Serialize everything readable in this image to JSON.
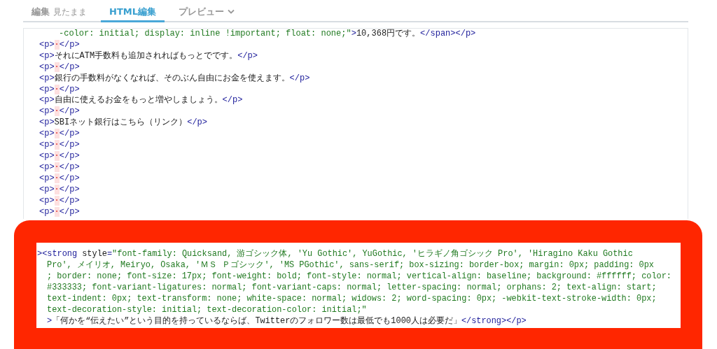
{
  "tabs": [
    {
      "label": "編集",
      "note": "見たまま",
      "selected": false,
      "has_menu": false
    },
    {
      "label": "HTML編集",
      "selected": true,
      "has_menu": false
    },
    {
      "label": "プレビュー",
      "selected": false,
      "has_menu": true
    }
  ],
  "editor_lines": [
    {
      "indent": true,
      "segments": [
        {
          "kind": "attr",
          "text": "-color: initial; display: inline !important; float: none;\""
        },
        {
          "kind": "tag",
          "text": ">"
        },
        {
          "kind": "text",
          "text": "10,368円です。"
        },
        {
          "kind": "tag",
          "text": "</span></p>"
        }
      ]
    },
    {
      "indent": false,
      "segments": [
        {
          "kind": "tag",
          "text": "<p>"
        },
        {
          "kind": "space",
          "text": "·"
        },
        {
          "kind": "tag",
          "text": "</p>"
        }
      ]
    },
    {
      "indent": false,
      "segments": [
        {
          "kind": "tag",
          "text": "<p>"
        },
        {
          "kind": "text",
          "text": "それにATM手数料も追加されればもっとでです。"
        },
        {
          "kind": "tag",
          "text": "</p>"
        }
      ]
    },
    {
      "indent": false,
      "segments": [
        {
          "kind": "tag",
          "text": "<p>"
        },
        {
          "kind": "space",
          "text": "·"
        },
        {
          "kind": "tag",
          "text": "</p>"
        }
      ]
    },
    {
      "indent": false,
      "segments": [
        {
          "kind": "tag",
          "text": "<p>"
        },
        {
          "kind": "text",
          "text": "銀行の手数料がなくなれば、そのぶん自由にお金を使えます。"
        },
        {
          "kind": "tag",
          "text": "</p>"
        }
      ]
    },
    {
      "indent": false,
      "segments": [
        {
          "kind": "tag",
          "text": "<p>"
        },
        {
          "kind": "space",
          "text": "·"
        },
        {
          "kind": "tag",
          "text": "</p>"
        }
      ]
    },
    {
      "indent": false,
      "segments": [
        {
          "kind": "tag",
          "text": "<p>"
        },
        {
          "kind": "text",
          "text": "自由に使えるお金をもっと増やしましょう。"
        },
        {
          "kind": "tag",
          "text": "</p>"
        }
      ]
    },
    {
      "indent": false,
      "segments": [
        {
          "kind": "tag",
          "text": "<p>"
        },
        {
          "kind": "space",
          "text": "·"
        },
        {
          "kind": "tag",
          "text": "</p>"
        }
      ]
    },
    {
      "indent": false,
      "segments": [
        {
          "kind": "tag",
          "text": "<p>"
        },
        {
          "kind": "text",
          "text": "SBIネット銀行はこちら（リンク）"
        },
        {
          "kind": "tag",
          "text": "</p>"
        }
      ]
    },
    {
      "indent": false,
      "segments": [
        {
          "kind": "tag",
          "text": "<p>"
        },
        {
          "kind": "space",
          "text": "·"
        },
        {
          "kind": "tag",
          "text": "</p>"
        }
      ]
    },
    {
      "indent": false,
      "segments": [
        {
          "kind": "tag",
          "text": "<p>"
        },
        {
          "kind": "space",
          "text": "·"
        },
        {
          "kind": "tag",
          "text": "</p>"
        }
      ]
    },
    {
      "indent": false,
      "segments": [
        {
          "kind": "tag",
          "text": "<p>"
        },
        {
          "kind": "space",
          "text": "·"
        },
        {
          "kind": "tag",
          "text": "</p>"
        }
      ]
    },
    {
      "indent": false,
      "segments": [
        {
          "kind": "tag",
          "text": "<p>"
        },
        {
          "kind": "space",
          "text": "·"
        },
        {
          "kind": "tag",
          "text": "</p>"
        }
      ]
    },
    {
      "indent": false,
      "segments": [
        {
          "kind": "tag",
          "text": "<p>"
        },
        {
          "kind": "space",
          "text": "·"
        },
        {
          "kind": "tag",
          "text": "</p>"
        }
      ]
    },
    {
      "indent": false,
      "segments": [
        {
          "kind": "tag",
          "text": "<p>"
        },
        {
          "kind": "space",
          "text": "·"
        },
        {
          "kind": "tag",
          "text": "</p>"
        }
      ]
    },
    {
      "indent": false,
      "segments": [
        {
          "kind": "tag",
          "text": "<p>"
        },
        {
          "kind": "space",
          "text": "·"
        },
        {
          "kind": "tag",
          "text": "</p>"
        }
      ]
    },
    {
      "indent": false,
      "segments": [
        {
          "kind": "tag",
          "text": "<p>"
        },
        {
          "kind": "space",
          "text": "·"
        },
        {
          "kind": "tag",
          "text": "</p>"
        }
      ]
    }
  ],
  "highlight_lines": [
    {
      "indent": false,
      "segments": [
        {
          "kind": "tag",
          "text": "><strong"
        },
        {
          "kind": "text",
          "text": " style"
        },
        {
          "kind": "tag",
          "text": "="
        },
        {
          "kind": "attr",
          "text": "\"font-family: Quicksand, 游ゴシック体, 'Yu Gothic', YuGothic, 'ヒラギノ角ゴシック Pro', 'Hiragino Kaku Gothic"
        }
      ]
    },
    {
      "indent": true,
      "segments": [
        {
          "kind": "attr",
          "text": "Pro', メイリオ, Meiryo, Osaka, 'ＭＳ Ｐゴシック', 'MS PGothic', sans-serif; box-sizing: border-box; margin: 0px; padding: 0px"
        }
      ]
    },
    {
      "indent": true,
      "segments": [
        {
          "kind": "attr",
          "text": "; border: none; font-size: 17px; font-weight: bold; font-style: normal; vertical-align: baseline; background: #ffffff; color:"
        }
      ]
    },
    {
      "indent": true,
      "segments": [
        {
          "kind": "attr",
          "text": "#333333; font-variant-ligatures: normal; font-variant-caps: normal; letter-spacing: normal; orphans: 2; text-align: start;"
        }
      ]
    },
    {
      "indent": true,
      "segments": [
        {
          "kind": "attr",
          "text": "text-indent: 0px; text-transform: none; white-space: normal; widows: 2; word-spacing: 0px; -webkit-text-stroke-width: 0px;"
        }
      ]
    },
    {
      "indent": true,
      "segments": [
        {
          "kind": "attr",
          "text": "text-decoration-style: initial; text-decoration-color: initial;\""
        }
      ]
    },
    {
      "indent": true,
      "segments": [
        {
          "kind": "tag",
          "text": ">"
        },
        {
          "kind": "text",
          "text": "「何かを“伝えたい”という目的を持っているならば、Twitterのフォロワー数は最低でも1000人は必要だ」"
        },
        {
          "kind": "tag",
          "text": "</strong></p>"
        }
      ]
    }
  ]
}
